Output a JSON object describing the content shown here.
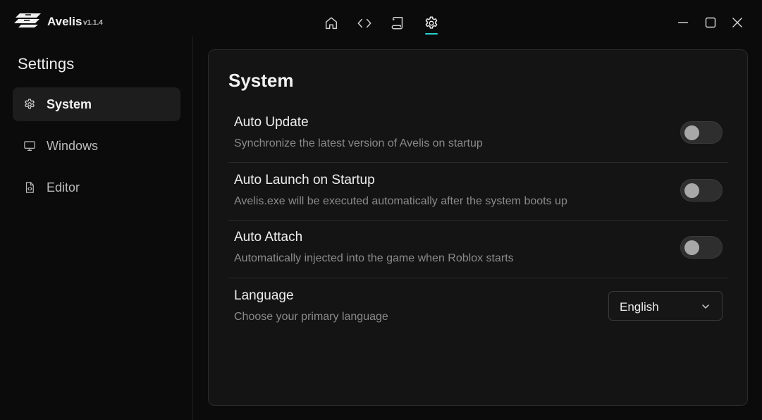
{
  "app": {
    "name": "Avelis",
    "version": "v1.1.4",
    "logo_icon": "avelis-logo-icon"
  },
  "top_nav": [
    {
      "name": "home",
      "icon": "home-icon",
      "active": false
    },
    {
      "name": "editor",
      "icon": "code-icon",
      "active": false
    },
    {
      "name": "scripts",
      "icon": "scroll-icon",
      "active": false
    },
    {
      "name": "settings",
      "icon": "gear-icon",
      "active": true
    }
  ],
  "window_controls": [
    "minimize-icon",
    "maximize-icon",
    "close-icon"
  ],
  "sidebar": {
    "title": "Settings",
    "items": [
      {
        "label": "System",
        "icon": "gear-icon",
        "active": true
      },
      {
        "label": "Windows",
        "icon": "monitor-icon",
        "active": false
      },
      {
        "label": "Editor",
        "icon": "file-code-icon",
        "active": false
      }
    ]
  },
  "panel": {
    "title": "System",
    "settings": [
      {
        "title": "Auto Update",
        "description": "Synchronize the latest version of Avelis on startup",
        "enabled": false
      },
      {
        "title": "Auto Launch on Startup",
        "description": "Avelis.exe will be executed automatically after the system boots up",
        "enabled": false
      },
      {
        "title": "Auto Attach",
        "description": "Automatically injected into the game when Roblox starts",
        "enabled": false
      }
    ],
    "language": {
      "title": "Language",
      "description": "Choose your primary language",
      "selected": "English"
    }
  },
  "colors": {
    "background": "#0b0b0b",
    "panel": "#141414",
    "accent": "#2ad0d0",
    "toggle_off": "#2e2e2e"
  }
}
